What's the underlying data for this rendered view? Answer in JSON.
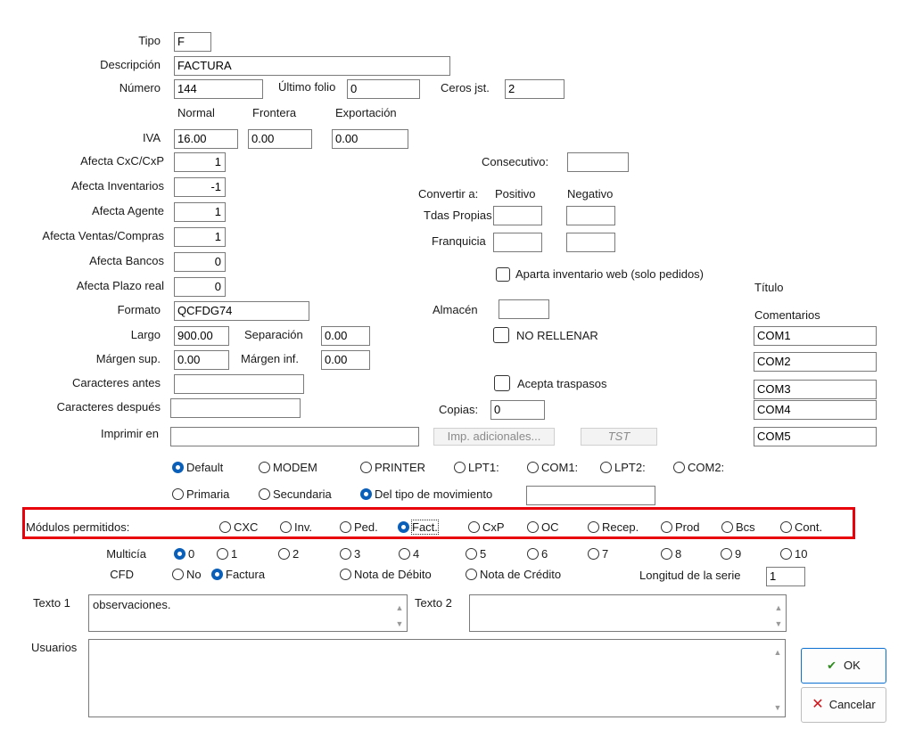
{
  "form": {
    "tipo": {
      "label": "Tipo",
      "value": "F"
    },
    "descripcion": {
      "label": "Descripción",
      "value": "FACTURA"
    },
    "numero": {
      "label": "Número",
      "value": "144"
    },
    "ultimo_folio": {
      "label": "Último folio",
      "value": "0"
    },
    "ceros": {
      "label": "Ceros jst.",
      "value": "2"
    },
    "iva_headers": [
      "Normal",
      "Frontera",
      "Exportación"
    ],
    "iva": {
      "label": "IVA",
      "normal": "16.00",
      "frontera": "0.00",
      "exportacion": "0.00"
    },
    "afecta": [
      {
        "label": "Afecta CxC/CxP",
        "value": "1"
      },
      {
        "label": "Afecta Inventarios",
        "value": "-1"
      },
      {
        "label": "Afecta Agente",
        "value": "1"
      },
      {
        "label": "Afecta Ventas/Compras",
        "value": "1"
      },
      {
        "label": "Afecta Bancos",
        "value": "0"
      },
      {
        "label": "Afecta Plazo real",
        "value": "0"
      }
    ],
    "consecutivo": {
      "label": "Consecutivo:",
      "value": ""
    },
    "convertir": {
      "label": "Convertir a:",
      "positivo": "Positivo",
      "negativo": "Negativo",
      "tdas": "Tdas Propias",
      "franquicia": "Franquicia"
    },
    "aparta": "Aparta inventario web (solo pedidos)",
    "titulo": "Título",
    "formato": {
      "label": "Formato",
      "value": "QCFDG74"
    },
    "almacen": {
      "label": "Almacén",
      "value": ""
    },
    "comentarios": {
      "label": "Comentarios",
      "values": [
        "COM1",
        "COM2",
        "COM3",
        "COM4",
        "COM5"
      ]
    },
    "largo": {
      "label": "Largo",
      "value": "900.00"
    },
    "separacion": {
      "label": "Separación",
      "value": "0.00"
    },
    "no_rellenar": "NO RELLENAR",
    "margen_sup": {
      "label": "Márgen sup.",
      "value": "0.00"
    },
    "margen_inf": {
      "label": "Márgen inf.",
      "value": "0.00"
    },
    "car_antes": {
      "label": "Caracteres antes",
      "value": ""
    },
    "acepta": "Acepta traspasos",
    "car_despues": {
      "label": "Caracteres después",
      "value": ""
    },
    "copias": {
      "label": "Copias:",
      "value": "0"
    },
    "imprimir": {
      "label": "Imprimir en",
      "value": ""
    },
    "imp_adic": "Imp. adicionales...",
    "tst": "TST",
    "puertos": [
      "Default",
      "MODEM",
      "PRINTER",
      "LPT1:",
      "COM1:",
      "LPT2:",
      "COM2:"
    ],
    "origen": [
      "Primaria",
      "Secundaria",
      "Del tipo de movimiento"
    ],
    "modulos": {
      "label": "Módulos permitidos:",
      "items": [
        "CXC",
        "Inv.",
        "Ped.",
        "Fact.",
        "CxP",
        "OC",
        "Recep.",
        "Prod",
        "Bcs",
        "Cont."
      ]
    },
    "multicia": {
      "label": "Multicía",
      "items": [
        "0",
        "1",
        "2",
        "3",
        "4",
        "5",
        "6",
        "7",
        "8",
        "9",
        "10"
      ]
    },
    "cfd": {
      "label": "CFD",
      "items": [
        "No",
        "Factura",
        "Nota de Débito",
        "Nota de Crédito"
      ]
    },
    "longitud": {
      "label": "Longitud de la serie",
      "value": "1"
    },
    "texto1": {
      "label": "Texto 1",
      "value": "observaciones."
    },
    "texto2": {
      "label": "Texto 2",
      "value": ""
    },
    "usuarios": {
      "label": "Usuarios",
      "value": ""
    },
    "ok": "OK",
    "cancelar": "Cancelar"
  },
  "colors": {
    "accent": "#0a5fb8",
    "highlight": "#e8000b"
  }
}
